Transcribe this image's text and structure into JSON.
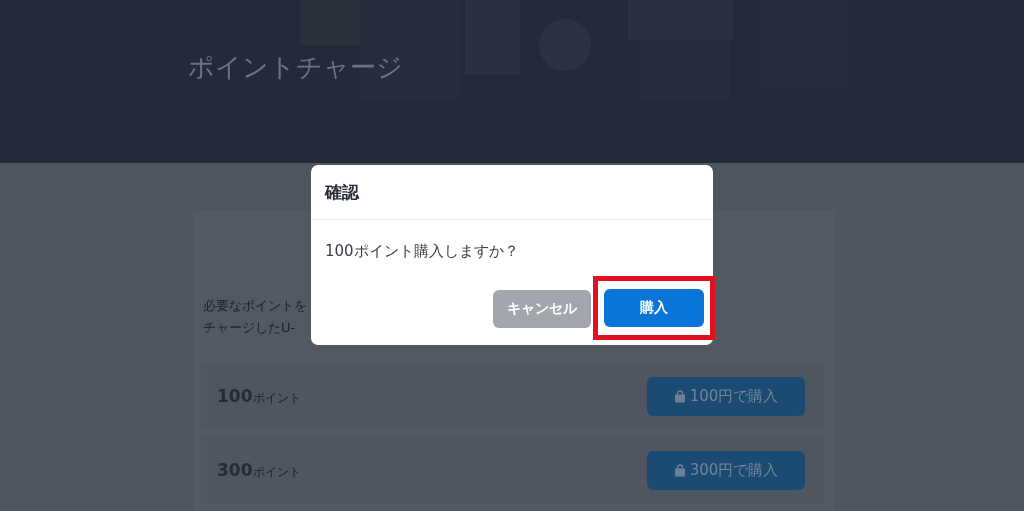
{
  "header": {
    "title": "ポイントチャージ"
  },
  "intro": {
    "lines": [
      "必要なポイントを",
      "チャージしたU-"
    ]
  },
  "plans": [
    {
      "amount": "100",
      "unit": "ポイント",
      "button": "100円で購入"
    },
    {
      "amount": "300",
      "unit": "ポイント",
      "button": "300円で購入"
    }
  ],
  "dialog": {
    "title": "確認",
    "message": "100ポイント購入しますか？",
    "buttons": [
      {
        "label": "キャンセル",
        "kind": "cancel",
        "highlighted": false
      },
      {
        "label": "購入",
        "kind": "primary",
        "highlighted": true
      }
    ]
  }
}
